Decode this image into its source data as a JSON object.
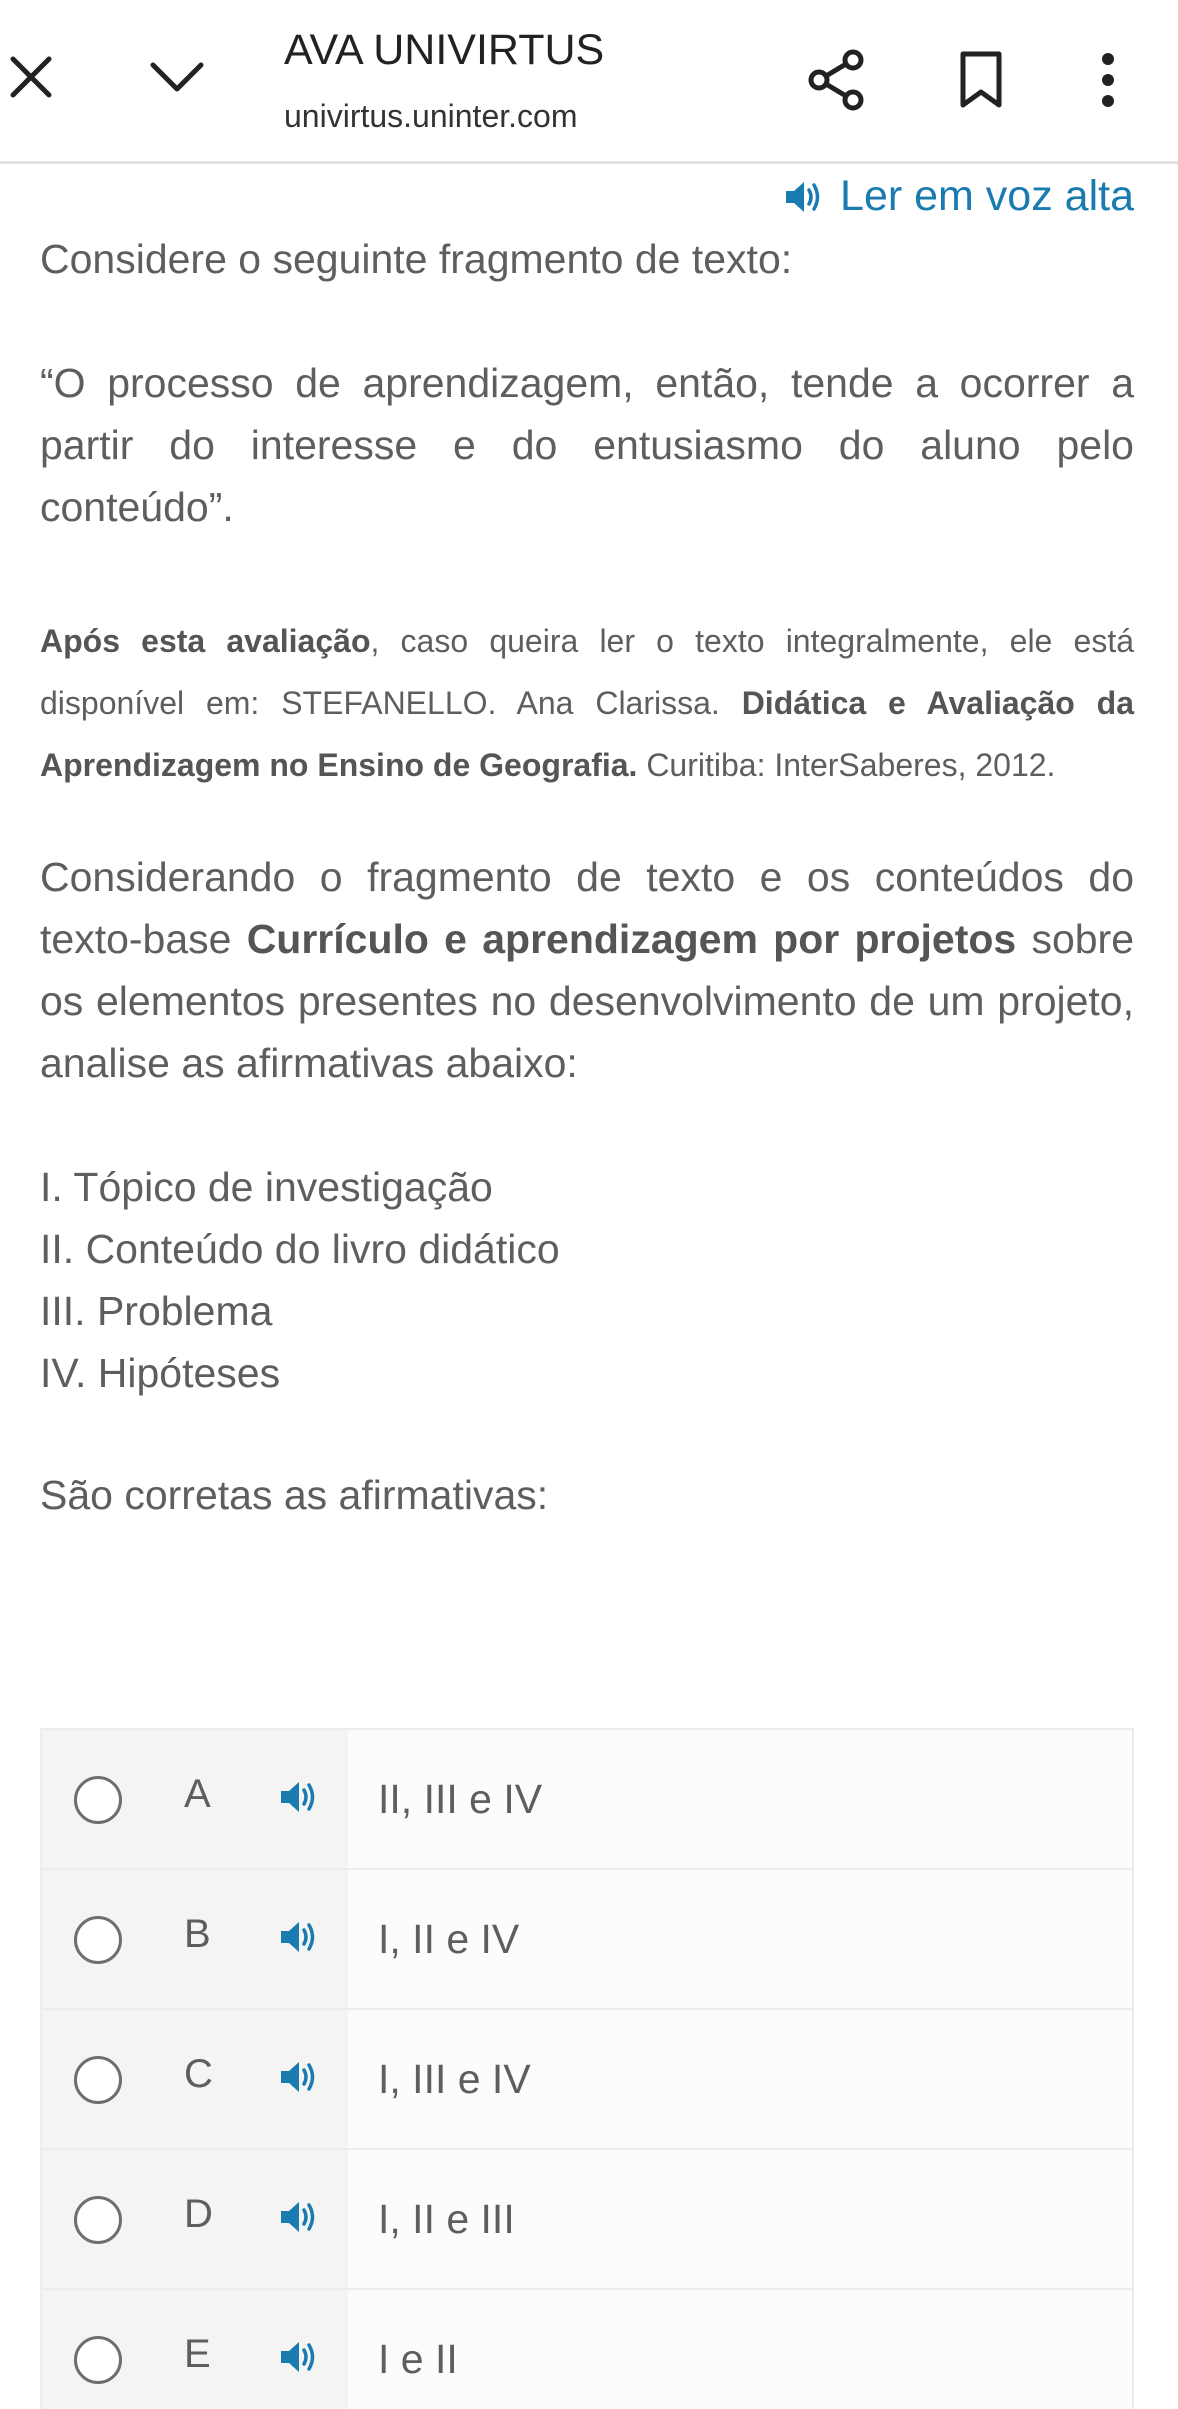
{
  "browser": {
    "title": "AVA UNIVIRTUS",
    "url": "univirtus.uninter.com",
    "icons": {
      "close": "close-icon",
      "minimize": "chevron-down-icon",
      "share": "share-icon",
      "bookmark": "bookmark-icon",
      "more": "more-vert-icon"
    }
  },
  "read_aloud": {
    "label": "Ler em voz alta",
    "icon": "speaker-icon",
    "color": "#1a7bb0"
  },
  "question": {
    "intro": "Considere o seguinte fragmento de texto:",
    "quote": "“O processo de aprendizagem, então, tende a ocorrer a partir do interesse e do entusiasmo do aluno pelo conteúdo”.",
    "reference": {
      "bold1": "Após esta avaliação",
      "text1": ", caso queira ler o texto integralmente, ele está disponível em: STEFANELLO. Ana Clarissa. ",
      "bold2": "Didática e Avaliação da Aprendizagem no Ensino de Geografia.",
      "text2": " Curitiba: InterSaberes, 2012."
    },
    "context": {
      "text1": "Considerando o fragmento de texto e os conteúdos do texto-base ",
      "bold": "Currículo e aprendizagem por projetos",
      "text2": " sobre os elementos presentes no desenvolvimento de um projeto, analise as afirmativas abaixo:"
    },
    "items": [
      "I. Tópico de investigação",
      "II. Conteúdo do livro didático",
      "III. Problema",
      "IV. Hipóteses"
    ],
    "prompt": "São corretas as afirmativas:"
  },
  "options": [
    {
      "letter": "A",
      "text": "II, III e IV"
    },
    {
      "letter": "B",
      "text": "I, II e IV"
    },
    {
      "letter": "C",
      "text": "I, III e IV"
    },
    {
      "letter": "D",
      "text": "I, II e III"
    },
    {
      "letter": "E",
      "text": "I e II"
    }
  ]
}
